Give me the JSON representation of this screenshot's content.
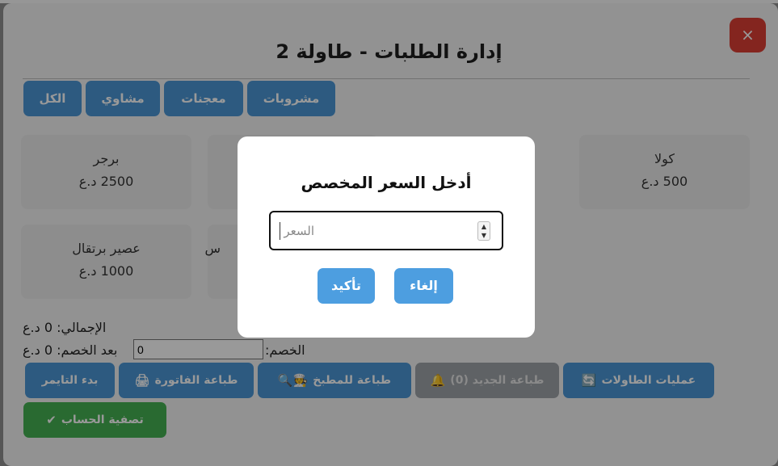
{
  "window": {
    "title": "إدارة الطلبات - طاولة 2",
    "close_label": "×"
  },
  "categories": [
    {
      "label": "مشروبات"
    },
    {
      "label": "معجنات"
    },
    {
      "label": "مشاوي"
    },
    {
      "label": "الكل"
    }
  ],
  "products": [
    {
      "name": "كولا",
      "price": "500 د.ع"
    },
    {
      "name": "برجر",
      "price": "2500 د.ع"
    },
    {
      "name": "عصير برتقال",
      "price": "1000 د.ع"
    },
    {
      "name": "س",
      "price": ""
    }
  ],
  "summary": {
    "total": "الإجمالي: 0 د.ع",
    "discount_label": "الخصم:",
    "discount_value": "0",
    "after_discount": "بعد الخصم: 0 د.ع"
  },
  "actions": {
    "tables_ops": "عمليات الطاولات",
    "print_new": "طباعة الجديد (0)",
    "print_kitchen": "طباعة للمطبخ",
    "print_invoice": "طباعة الفاتورة",
    "start_timer": "بدء التايمر",
    "settle": "تصفية الحساب"
  },
  "icons": {
    "tables": "refresh-icon",
    "bell": "bell-icon",
    "chef": "chef-icon",
    "printer": "printer-icon",
    "check": "check-icon"
  },
  "dialog": {
    "title": "أدخل السعر المخصص",
    "input_placeholder": "السعر",
    "cancel_label": "إلغاء",
    "confirm_label": "تأكيد"
  },
  "colors": {
    "primary": "#4b97d6",
    "danger": "#dc3f35",
    "success": "#45b153",
    "disabled": "#9fa4a8"
  }
}
